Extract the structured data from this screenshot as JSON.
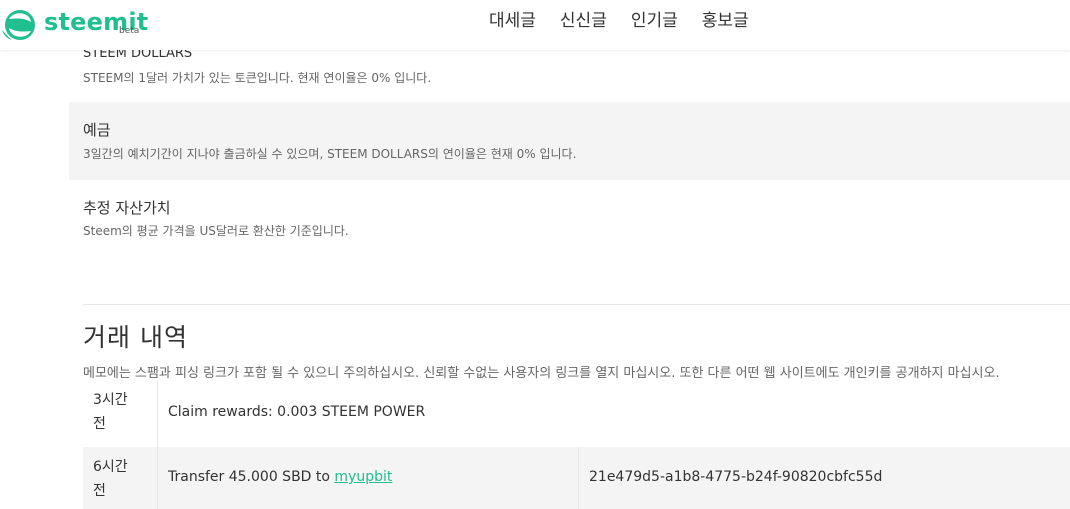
{
  "header": {
    "logo_text": "steemit",
    "logo_badge": "beta",
    "brand_color": "#1fbf8f",
    "nav": [
      "대세글",
      "신신글",
      "인기글",
      "홍보글"
    ]
  },
  "balances": {
    "steem_dollars": {
      "title": "STEEM DOLLARS",
      "desc": "STEEM의 1달러 가치가 있는 토큰입니다. 현재 연이율은 0% 입니다."
    },
    "savings": {
      "title": "예금",
      "desc": "3일간의 예치기간이 지나야 출금하실 수 있으며, STEEM DOLLARS의 연이율은 현재 0% 입니다."
    },
    "estimated": {
      "title": "추정 자산가치",
      "desc": "Steem의 평균 가격을 US달러로 환산한 기준입니다."
    }
  },
  "history": {
    "title": "거래 내역",
    "notice": "메모에는 스팸과 피싱 링크가 포함 될 수 있으니 주의하십시오. 신뢰할 수없는 사용자의 링크를 열지 마십시오. 또한 다른 어떤 웹 사이트에도 개인키를 공개하지 마십시오.",
    "rows": [
      {
        "time_line1": "3시간",
        "time_line2": "전",
        "op": "Claim rewards: 0.003 STEEM POWER",
        "memo": ""
      },
      {
        "time_line1": "6시간",
        "time_line2": "전",
        "op_prefix": "Transfer 45.000 SBD to ",
        "op_link": "myupbit",
        "memo": "21e479d5-a1b8-4775-b24f-90820cbfc55d"
      }
    ]
  }
}
